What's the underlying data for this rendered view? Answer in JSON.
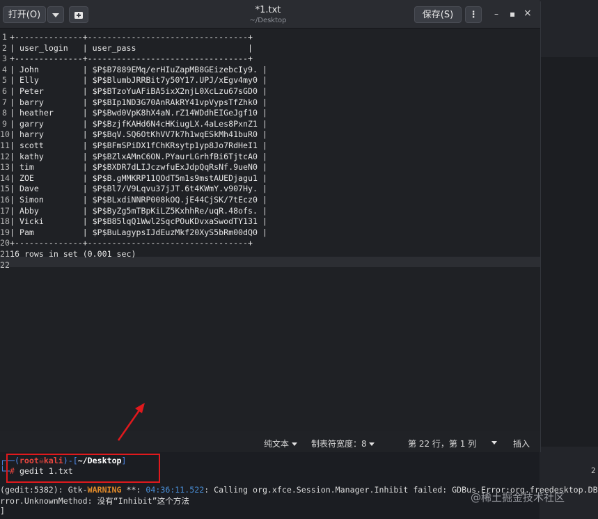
{
  "headerbar": {
    "open_label": "打开(O)",
    "title": "*1.txt",
    "subtitle": "~/Desktop",
    "save_label": "保存(S)",
    "menu_glyph": "⋮",
    "minimize_glyph": "–",
    "maximize_glyph": "▪",
    "close_glyph": "×"
  },
  "editor": {
    "lines": [
      "+--------------+---------------------------------+",
      "| user_login   | user_pass                       |",
      "+--------------+---------------------------------+",
      "| John         | $P$B7889EMq/erHIuZapMB8GEizebcIy9. |",
      "| Elly         | $P$BlumbJRRBit7y50Y17.UPJ/xEgv4my0 |",
      "| Peter        | $P$BTzoYuAFiBA5ixX2njL0XcLzu67sGD0 |",
      "| barry        | $P$BIp1ND3G70AnRAkRY41vpVypsTfZhk0 |",
      "| heather      | $P$Bwd0VpK8hX4aN.rZ14WDdhEIGeJgf10 |",
      "| garry        | $P$BzjfKAHd6N4cHKiugLX.4aLes8PxnZ1 |",
      "| harry        | $P$BqV.SQ6OtKhVV7k7h1wqESkMh41buR0 |",
      "| scott        | $P$BFmSPiDX1fChKRsytp1yp8Jo7RdHeI1 |",
      "| kathy        | $P$BZlxAMnC6ON.PYaurLGrhfBi6TjtcA0 |",
      "| tim          | $P$BXDR7dLIJczwfuExJdpQqRsNf.9ueN0 |",
      "| ZOE          | $P$B.gMMKRP11QOdT5m1s9mstAUEDjagu1 |",
      "| Dave         | $P$Bl7/V9Lqvu37jJT.6t4KWmY.v907Hy. |",
      "| Simon        | $P$BLxdiNNRP008kOQ.jE44CjSK/7tEcz0 |",
      "| Abby         | $P$ByZg5mTBpKiLZ5KxhhRe/uqR.48ofs. |",
      "| Vicki        | $P$B85lqQ1Wwl2SqcPOuKDvxaSwodTY131 |",
      "| Pam          | $P$BuLagypsIJdEuzMkf20XyS5bRm00dQ0 |",
      "+--------------+---------------------------------+",
      "16 rows in set (0.001 sec)",
      ""
    ],
    "line_numbers": [
      "1",
      "2",
      "3",
      "4",
      "5",
      "6",
      "7",
      "8",
      "9",
      "10",
      "11",
      "12",
      "13",
      "14",
      "15",
      "16",
      "17",
      "18",
      "19",
      "20",
      "21",
      "22"
    ]
  },
  "statusbar": {
    "mode": "纯文本",
    "tab_width": "制表符宽度：8",
    "position": "第 22 行，第 1 列",
    "insert": "插入"
  },
  "terminal": {
    "prompt_user": "root",
    "prompt_host": "kali",
    "prompt_dir": "~/Desktop",
    "command": "gedit 1.txt",
    "warn_prefix": "(gedit:5382): Gtk-",
    "warn_level": "WARNING",
    "warn_stars": " **: ",
    "warn_time": "04:36:11.522",
    "warn_msg": ": Calling org.xfce.Session.Manager.Inhibit failed: GDBus.Error:org.freedesktop.DBu",
    "error_line": "rror.UnknownMethod: 没有“Inhibit”这个方法",
    "last_line": "]",
    "right_number": "2"
  },
  "watermark": "@稀土掘金技术社区",
  "colors": {
    "accent_red": "#e0191d",
    "prompt_blue": "#4f8cf0",
    "prompt_red": "#e8463f",
    "warning_orange": "#e08a2a",
    "time_blue": "#4a90d9"
  }
}
